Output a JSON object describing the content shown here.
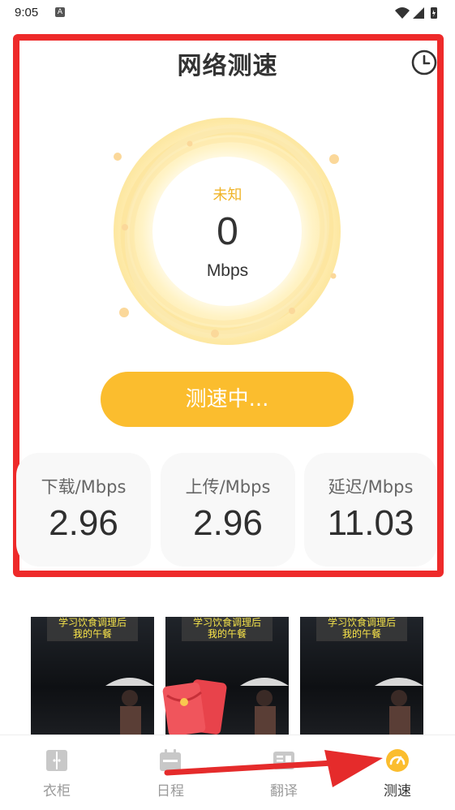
{
  "status_bar": {
    "time": "9:05",
    "notification_icon": "A"
  },
  "header": {
    "title": "网络测速",
    "history_icon": "clock-icon"
  },
  "gauge": {
    "status_text": "未知",
    "value": "0",
    "unit": "Mbps"
  },
  "action_button": {
    "label": "测速中..."
  },
  "stats": [
    {
      "label": "下载/Mbps",
      "value": "2.96"
    },
    {
      "label": "上传/Mbps",
      "value": "2.96"
    },
    {
      "label": "延迟/Mbps",
      "value": "11.03"
    }
  ],
  "ad": {
    "thumbnails": [
      {
        "caption_line1": "学习饮食调理后",
        "caption_line2": "我的午餐"
      },
      {
        "caption_line1": "学习饮食调理后",
        "caption_line2": "我的午餐"
      },
      {
        "caption_line1": "学习饮食调理后",
        "caption_line2": "我的午餐"
      }
    ]
  },
  "bottom_nav": {
    "items": [
      {
        "label": "衣柜",
        "icon": "wardrobe-icon"
      },
      {
        "label": "日程",
        "icon": "calendar-icon"
      },
      {
        "label": "翻译",
        "icon": "translate-icon"
      },
      {
        "label": "测速",
        "icon": "speedometer-icon"
      }
    ],
    "active_index": 3
  },
  "colors": {
    "accent": "#fbbd2e",
    "highlight_border": "#ee2a2a",
    "card_bg": "#f8f8f8"
  }
}
